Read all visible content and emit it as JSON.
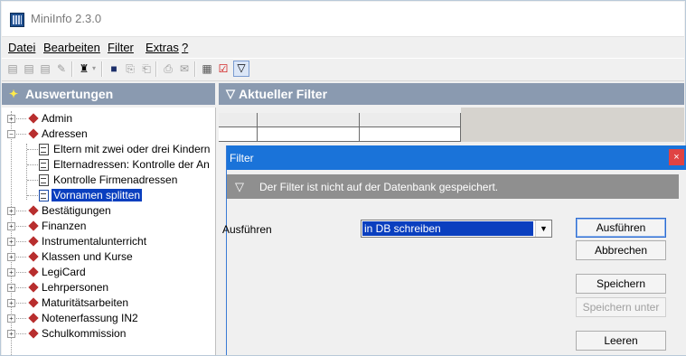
{
  "window": {
    "title": "MiniInfo 2.3.0"
  },
  "menu": [
    "Datei",
    "Bearbeiten",
    "Filter",
    "Extras",
    "?"
  ],
  "left_panel": {
    "title": "Auswertungen"
  },
  "right_panel": {
    "title": "Aktueller Filter"
  },
  "tree": {
    "nodes": [
      {
        "label": "Admin",
        "expander": "+"
      },
      {
        "label": "Adressen",
        "expander": "−"
      },
      {
        "label": "Eltern mit zwei oder drei Kindern"
      },
      {
        "label": "Elternadressen: Kontrolle der An"
      },
      {
        "label": "Kontrolle Firmenadressen"
      },
      {
        "label": "Vornamen splitten"
      },
      {
        "label": "Bestätigungen",
        "expander": "+"
      },
      {
        "label": "Finanzen",
        "expander": "+"
      },
      {
        "label": "Instrumentalunterricht",
        "expander": "+"
      },
      {
        "label": "Klassen und Kurse",
        "expander": "+"
      },
      {
        "label": "LegiCard",
        "expander": "+"
      },
      {
        "label": "Lehrpersonen",
        "expander": "+"
      },
      {
        "label": "Maturitätsarbeiten",
        "expander": "+"
      },
      {
        "label": "Notenerfassung IN2",
        "expander": "+"
      },
      {
        "label": "Schulkommission",
        "expander": "+"
      }
    ]
  },
  "dialog": {
    "title": "Filter",
    "close": "×",
    "info": "Der Filter ist nicht auf der Datenbank gespeichert.",
    "run_label": "Ausführen",
    "run_select_value": "in DB schreiben",
    "buttons": {
      "run": "Ausführen",
      "cancel": "Abbrechen",
      "save": "Speichern",
      "save_as": "Speichern unter",
      "clear": "Leeren"
    }
  },
  "colors": {
    "accent": "#1a73d9",
    "selection": "#0a3fbf",
    "panel_header": "#8a9ab0"
  }
}
